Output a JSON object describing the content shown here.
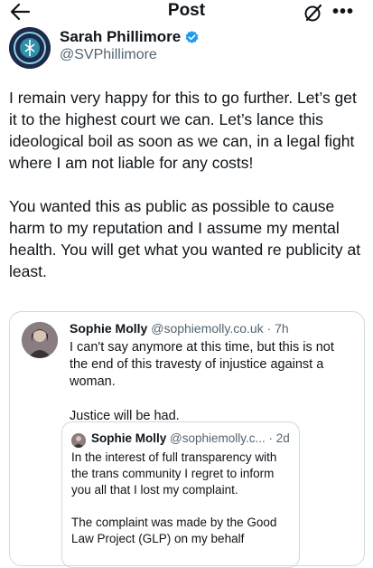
{
  "header": {
    "title": "Post"
  },
  "author": {
    "name": "Sarah Phillimore",
    "handle": "@SVPhillimore"
  },
  "post": {
    "paragraphs": [
      "I remain very happy for this to go further. Let’s get it to the highest court we can. Let’s lance this ideological boil as soon as we can, in a legal fight where I am not liable for any costs!",
      "You wanted this as public as possible to cause harm to my reputation and I assume my mental health. You will get what you wanted re publicity at least."
    ]
  },
  "quoted_post": {
    "name": "Sophie Molly",
    "handle": "@sophiemolly.co.uk",
    "time": "· 7h",
    "paragraphs": [
      "I can't say anymore at this time, but this is not the end of this travesty of injustice against a woman.",
      "Justice will be had."
    ]
  },
  "nested_quote": {
    "name": "Sophie Molly",
    "handle": "@sophiemolly.c...",
    "time": "· 2d",
    "paragraphs": [
      "In the interest of full transparency with the trans community I regret to inform you all that I lost my complaint.",
      "The complaint was made by the Good Law Project (GLP) on my behalf"
    ]
  },
  "colors": {
    "verified": "#1d9bf0",
    "secondary_text": "#536471",
    "border": "#cfd9de"
  },
  "icons": {
    "back": "arrow-left-icon",
    "grok": "grok-icon",
    "more": "more-icon",
    "verified": "verified-badge-icon"
  }
}
